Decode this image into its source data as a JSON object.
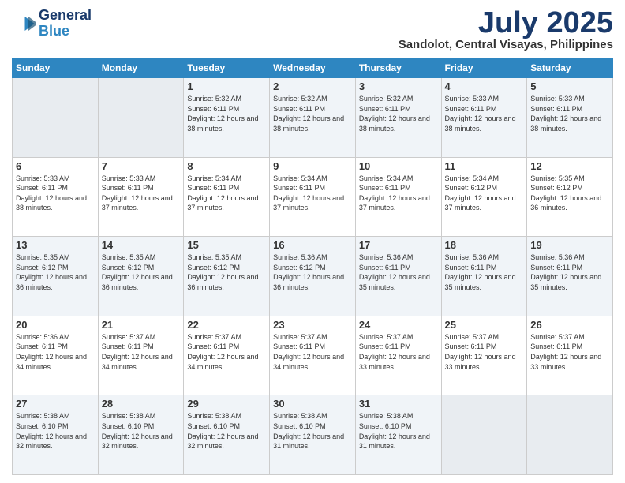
{
  "logo": {
    "text_general": "General",
    "text_blue": "Blue"
  },
  "header": {
    "month": "July 2025",
    "location": "Sandolot, Central Visayas, Philippines"
  },
  "weekdays": [
    "Sunday",
    "Monday",
    "Tuesday",
    "Wednesday",
    "Thursday",
    "Friday",
    "Saturday"
  ],
  "weeks": [
    [
      {
        "day": "",
        "empty": true
      },
      {
        "day": "",
        "empty": true
      },
      {
        "day": "1",
        "sunrise": "5:32 AM",
        "sunset": "6:11 PM",
        "daylight": "12 hours and 38 minutes."
      },
      {
        "day": "2",
        "sunrise": "5:32 AM",
        "sunset": "6:11 PM",
        "daylight": "12 hours and 38 minutes."
      },
      {
        "day": "3",
        "sunrise": "5:32 AM",
        "sunset": "6:11 PM",
        "daylight": "12 hours and 38 minutes."
      },
      {
        "day": "4",
        "sunrise": "5:33 AM",
        "sunset": "6:11 PM",
        "daylight": "12 hours and 38 minutes."
      },
      {
        "day": "5",
        "sunrise": "5:33 AM",
        "sunset": "6:11 PM",
        "daylight": "12 hours and 38 minutes."
      }
    ],
    [
      {
        "day": "6",
        "sunrise": "5:33 AM",
        "sunset": "6:11 PM",
        "daylight": "12 hours and 38 minutes."
      },
      {
        "day": "7",
        "sunrise": "5:33 AM",
        "sunset": "6:11 PM",
        "daylight": "12 hours and 37 minutes."
      },
      {
        "day": "8",
        "sunrise": "5:34 AM",
        "sunset": "6:11 PM",
        "daylight": "12 hours and 37 minutes."
      },
      {
        "day": "9",
        "sunrise": "5:34 AM",
        "sunset": "6:11 PM",
        "daylight": "12 hours and 37 minutes."
      },
      {
        "day": "10",
        "sunrise": "5:34 AM",
        "sunset": "6:11 PM",
        "daylight": "12 hours and 37 minutes."
      },
      {
        "day": "11",
        "sunrise": "5:34 AM",
        "sunset": "6:12 PM",
        "daylight": "12 hours and 37 minutes."
      },
      {
        "day": "12",
        "sunrise": "5:35 AM",
        "sunset": "6:12 PM",
        "daylight": "12 hours and 36 minutes."
      }
    ],
    [
      {
        "day": "13",
        "sunrise": "5:35 AM",
        "sunset": "6:12 PM",
        "daylight": "12 hours and 36 minutes."
      },
      {
        "day": "14",
        "sunrise": "5:35 AM",
        "sunset": "6:12 PM",
        "daylight": "12 hours and 36 minutes."
      },
      {
        "day": "15",
        "sunrise": "5:35 AM",
        "sunset": "6:12 PM",
        "daylight": "12 hours and 36 minutes."
      },
      {
        "day": "16",
        "sunrise": "5:36 AM",
        "sunset": "6:12 PM",
        "daylight": "12 hours and 36 minutes."
      },
      {
        "day": "17",
        "sunrise": "5:36 AM",
        "sunset": "6:11 PM",
        "daylight": "12 hours and 35 minutes."
      },
      {
        "day": "18",
        "sunrise": "5:36 AM",
        "sunset": "6:11 PM",
        "daylight": "12 hours and 35 minutes."
      },
      {
        "day": "19",
        "sunrise": "5:36 AM",
        "sunset": "6:11 PM",
        "daylight": "12 hours and 35 minutes."
      }
    ],
    [
      {
        "day": "20",
        "sunrise": "5:36 AM",
        "sunset": "6:11 PM",
        "daylight": "12 hours and 34 minutes."
      },
      {
        "day": "21",
        "sunrise": "5:37 AM",
        "sunset": "6:11 PM",
        "daylight": "12 hours and 34 minutes."
      },
      {
        "day": "22",
        "sunrise": "5:37 AM",
        "sunset": "6:11 PM",
        "daylight": "12 hours and 34 minutes."
      },
      {
        "day": "23",
        "sunrise": "5:37 AM",
        "sunset": "6:11 PM",
        "daylight": "12 hours and 34 minutes."
      },
      {
        "day": "24",
        "sunrise": "5:37 AM",
        "sunset": "6:11 PM",
        "daylight": "12 hours and 33 minutes."
      },
      {
        "day": "25",
        "sunrise": "5:37 AM",
        "sunset": "6:11 PM",
        "daylight": "12 hours and 33 minutes."
      },
      {
        "day": "26",
        "sunrise": "5:37 AM",
        "sunset": "6:11 PM",
        "daylight": "12 hours and 33 minutes."
      }
    ],
    [
      {
        "day": "27",
        "sunrise": "5:38 AM",
        "sunset": "6:10 PM",
        "daylight": "12 hours and 32 minutes."
      },
      {
        "day": "28",
        "sunrise": "5:38 AM",
        "sunset": "6:10 PM",
        "daylight": "12 hours and 32 minutes."
      },
      {
        "day": "29",
        "sunrise": "5:38 AM",
        "sunset": "6:10 PM",
        "daylight": "12 hours and 32 minutes."
      },
      {
        "day": "30",
        "sunrise": "5:38 AM",
        "sunset": "6:10 PM",
        "daylight": "12 hours and 31 minutes."
      },
      {
        "day": "31",
        "sunrise": "5:38 AM",
        "sunset": "6:10 PM",
        "daylight": "12 hours and 31 minutes."
      },
      {
        "day": "",
        "empty": true
      },
      {
        "day": "",
        "empty": true
      }
    ]
  ]
}
